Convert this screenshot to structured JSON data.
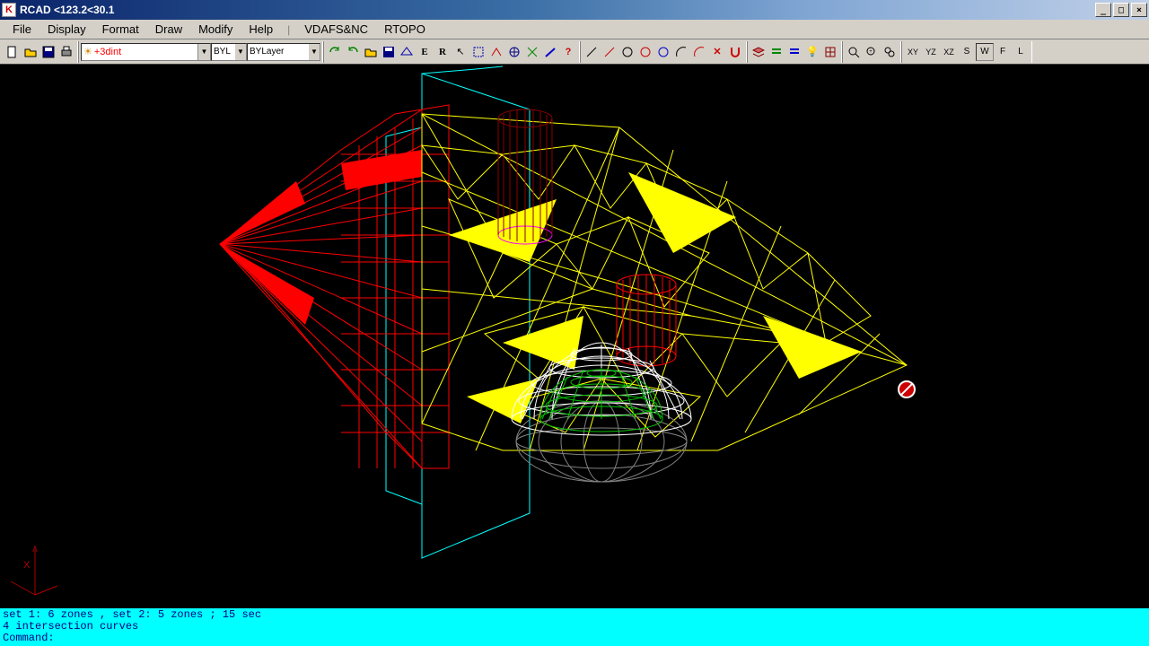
{
  "window": {
    "title": "RCAD  <123.2<30.1",
    "icon_letter": "K"
  },
  "menu": {
    "items": [
      "File",
      "Display",
      "Format",
      "Draw",
      "Modify",
      "Help"
    ],
    "extra": [
      "VDAFS&NC",
      "RTOPO"
    ]
  },
  "toolbar": {
    "layer_value": "+3dint",
    "color_value": "BYL",
    "linetype_value": "BYLayer",
    "view_buttons": [
      "XY",
      "YZ",
      "XZ",
      "S",
      "W",
      "F",
      "L"
    ]
  },
  "command": {
    "line1": "set 1: 6 zones , set 2: 5 zones ; 15 sec",
    "line2": "4 intersection curves",
    "prompt": "Command:"
  },
  "colors": {
    "wire_yellow": "#ffff00",
    "wire_red": "#ff0000",
    "wire_darkred": "#8b0000",
    "wire_green": "#00c000",
    "wire_cyan": "#00ffff",
    "wire_gray": "#888888",
    "wire_white": "#ffffff",
    "wire_magenta": "#ff00ff"
  },
  "ucs": {
    "label_x": "X"
  }
}
